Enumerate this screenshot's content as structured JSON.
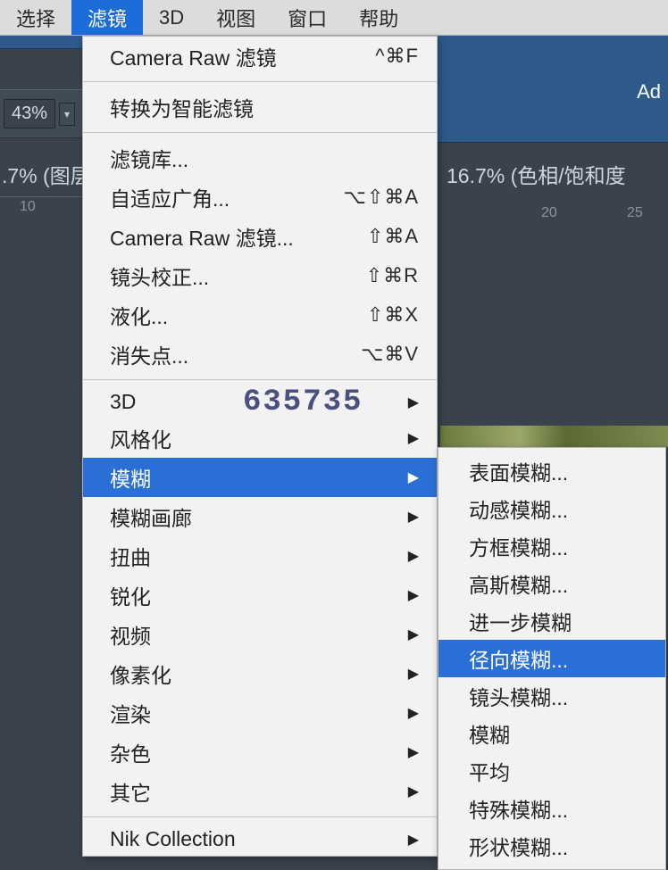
{
  "menubar": {
    "items": [
      {
        "label": "选择"
      },
      {
        "label": "滤镜"
      },
      {
        "label": "3D"
      },
      {
        "label": "视图"
      },
      {
        "label": "窗口"
      },
      {
        "label": "帮助"
      }
    ]
  },
  "toolbar": {
    "zoom": "43%"
  },
  "docTab1": ".7% (图层",
  "docTab2": "16.7% (色相/饱和度",
  "ruler1": {
    "t1": "10"
  },
  "ruler2": {
    "t1": "20",
    "t2": "25"
  },
  "rightStrip": {
    "adobe": "Ad"
  },
  "watermark": "635735",
  "filterMenu": {
    "group1": [
      {
        "label": "Camera Raw 滤镜",
        "shortcut": "^⌘F"
      }
    ],
    "group2": [
      {
        "label": "转换为智能滤镜"
      }
    ],
    "group3": [
      {
        "label": "滤镜库..."
      },
      {
        "label": "自适应广角...",
        "shortcut": "⌥⇧⌘A"
      },
      {
        "label": "Camera Raw 滤镜...",
        "shortcut": "⇧⌘A"
      },
      {
        "label": "镜头校正...",
        "shortcut": "⇧⌘R"
      },
      {
        "label": "液化...",
        "shortcut": "⇧⌘X"
      },
      {
        "label": "消失点...",
        "shortcut": "⌥⌘V"
      }
    ],
    "group4": [
      {
        "label": "3D",
        "submenu": true
      },
      {
        "label": "风格化",
        "submenu": true
      },
      {
        "label": "模糊",
        "submenu": true,
        "highlight": true
      },
      {
        "label": "模糊画廊",
        "submenu": true
      },
      {
        "label": "扭曲",
        "submenu": true
      },
      {
        "label": "锐化",
        "submenu": true
      },
      {
        "label": "视频",
        "submenu": true
      },
      {
        "label": "像素化",
        "submenu": true
      },
      {
        "label": "渲染",
        "submenu": true
      },
      {
        "label": "杂色",
        "submenu": true
      },
      {
        "label": "其它",
        "submenu": true
      }
    ],
    "group5": [
      {
        "label": "Nik Collection",
        "submenu": true
      }
    ]
  },
  "blurSubmenu": [
    {
      "label": "表面模糊..."
    },
    {
      "label": "动感模糊..."
    },
    {
      "label": "方框模糊..."
    },
    {
      "label": "高斯模糊..."
    },
    {
      "label": "进一步模糊"
    },
    {
      "label": "径向模糊...",
      "highlight": true
    },
    {
      "label": "镜头模糊..."
    },
    {
      "label": "模糊"
    },
    {
      "label": "平均"
    },
    {
      "label": "特殊模糊..."
    },
    {
      "label": "形状模糊..."
    }
  ]
}
